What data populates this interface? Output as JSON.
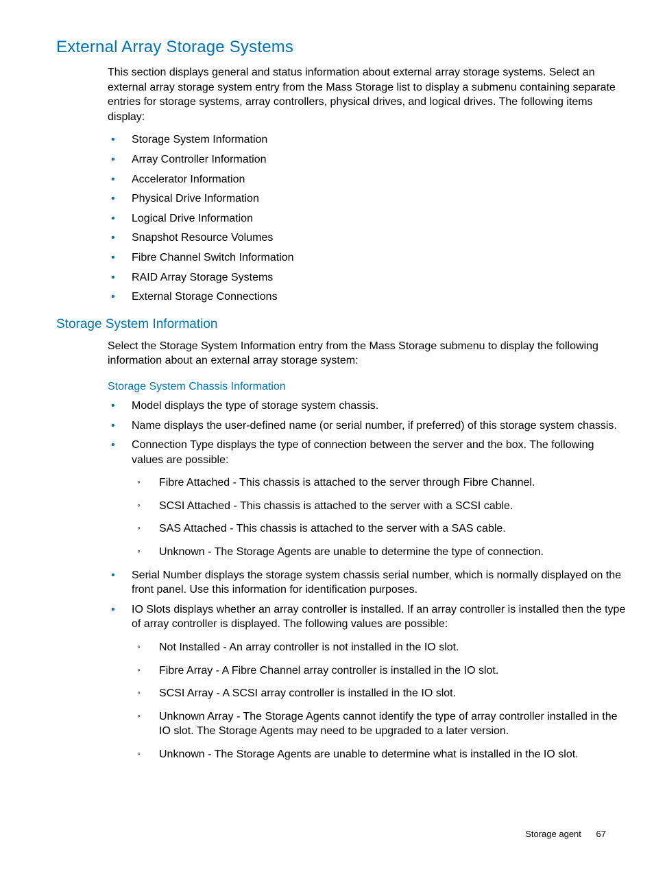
{
  "h1": "External Array Storage Systems",
  "intro": "This section displays general and status information about external array storage systems. Select an external array storage system entry from the Mass Storage list to display a submenu containing separate entries for storage systems, array controllers, physical drives, and logical drives. The following items display:",
  "topList": [
    "Storage System Information",
    "Array Controller Information",
    "Accelerator Information",
    "Physical Drive Information",
    "Logical Drive Information",
    "Snapshot Resource Volumes",
    "Fibre Channel Switch Information",
    "RAID Array Storage Systems",
    "External Storage Connections"
  ],
  "h2": "Storage System Information",
  "p2": "Select the Storage System Information entry from the Mass Storage submenu to display the following information about an external array storage system:",
  "h3": "Storage System Chassis Information",
  "chassis": {
    "model": "Model displays the type of storage system chassis.",
    "name": "Name displays the user-defined name (or serial number, if preferred) of this storage system chassis.",
    "connType": "Connection Type displays the type of connection between the server and the box. The following values are possible:",
    "connSub": [
      "Fibre Attached - This chassis is attached to the server through Fibre Channel.",
      "SCSI Attached - This chassis is attached to the server with a SCSI cable.",
      "SAS Attached - This chassis is attached to the server with a SAS cable.",
      "Unknown - The Storage Agents are unable to determine the type of connection."
    ],
    "serial": "Serial Number displays the storage system chassis serial number, which is normally displayed on the front panel. Use this information for identification purposes.",
    "ioslots": "IO Slots displays whether an array controller is installed. If an array controller is installed then the type of array controller is displayed. The following values are possible:",
    "ioSub": [
      "Not Installed - An array controller is not installed in the IO slot.",
      "Fibre Array - A Fibre Channel array controller is installed in the IO slot.",
      "SCSI Array - A SCSI array controller is installed in the IO slot.",
      "Unknown Array - The Storage Agents cannot identify the type of array controller installed in the IO slot. The Storage Agents may need to be upgraded to a later version.",
      "Unknown - The Storage Agents are unable to determine what is installed in the IO slot."
    ]
  },
  "footer": {
    "section": "Storage agent",
    "page": "67"
  }
}
